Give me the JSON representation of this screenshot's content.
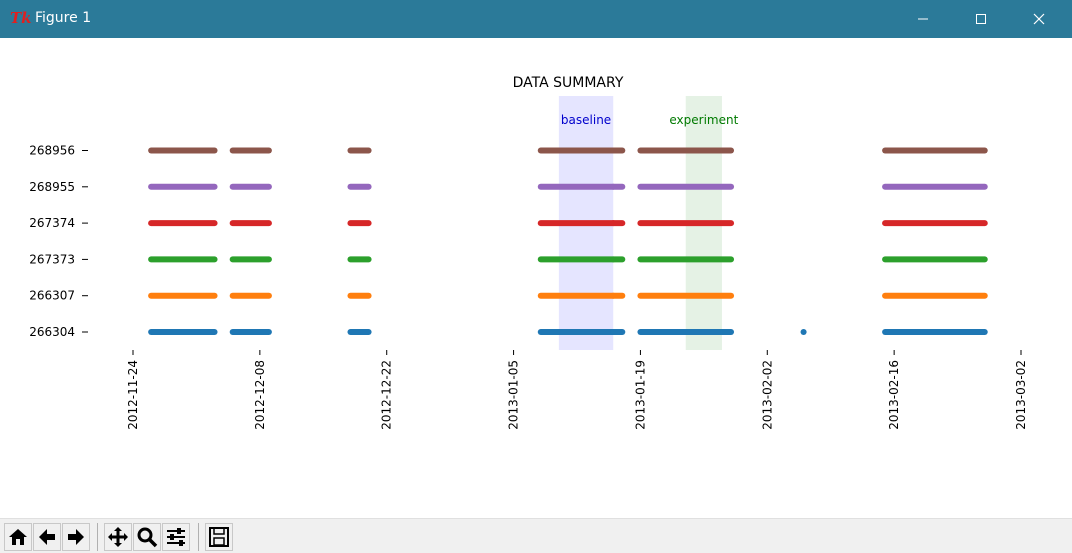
{
  "window": {
    "title": "Figure 1",
    "icon": "tk-feather-icon",
    "titlebar_color": "#2b7a99"
  },
  "toolbar": {
    "buttons": [
      "home-icon",
      "back-arrow-icon",
      "forward-arrow-icon",
      "pan-icon",
      "zoom-icon",
      "configure-subplots-icon",
      "save-icon"
    ]
  },
  "chart_data": {
    "type": "scatter",
    "title": "DATA SUMMARY",
    "xlabel": "",
    "ylabel": "",
    "x_type": "date",
    "xlim": [
      "2012-11-24",
      "2013-03-02"
    ],
    "x_ticks": [
      "2012-11-24",
      "2012-12-08",
      "2012-12-22",
      "2013-01-05",
      "2013-01-19",
      "2013-02-02",
      "2013-02-16",
      "2013-03-02"
    ],
    "categories": [
      "266304",
      "266307",
      "267373",
      "267374",
      "268955",
      "268956"
    ],
    "series_colors": [
      "#1f77b4",
      "#ff7f0e",
      "#2ca02c",
      "#d62728",
      "#9467bd",
      "#8c564b"
    ],
    "grid": false,
    "legend": "none",
    "spans": [
      {
        "label": "baseline",
        "start": "2013-01-10",
        "end": "2013-01-16",
        "color": "#0000ff",
        "opacity": 0.1
      },
      {
        "label": "experiment",
        "start": "2013-01-24",
        "end": "2013-01-28",
        "color": "#008000",
        "opacity": 0.1
      }
    ],
    "series": [
      {
        "category": "266304",
        "segments": [
          [
            "2012-11-26",
            "2012-12-03"
          ],
          [
            "2012-12-05",
            "2012-12-09"
          ],
          [
            "2012-12-18",
            "2012-12-20"
          ],
          [
            "2013-01-08",
            "2013-01-16"
          ],
          [
            "2013-01-16",
            "2013-01-17"
          ],
          [
            "2013-01-19",
            "2013-01-29"
          ],
          [
            "2013-02-06",
            "2013-02-06"
          ],
          [
            "2013-02-15",
            "2013-02-26"
          ]
        ]
      },
      {
        "category": "266307",
        "segments": [
          [
            "2012-11-26",
            "2012-12-03"
          ],
          [
            "2012-12-05",
            "2012-12-09"
          ],
          [
            "2012-12-18",
            "2012-12-20"
          ],
          [
            "2013-01-08",
            "2013-01-16"
          ],
          [
            "2013-01-16",
            "2013-01-17"
          ],
          [
            "2013-01-19",
            "2013-01-29"
          ],
          [
            "2013-02-15",
            "2013-02-26"
          ]
        ]
      },
      {
        "category": "267373",
        "segments": [
          [
            "2012-11-26",
            "2012-12-03"
          ],
          [
            "2012-12-05",
            "2012-12-09"
          ],
          [
            "2012-12-18",
            "2012-12-20"
          ],
          [
            "2013-01-08",
            "2013-01-16"
          ],
          [
            "2013-01-16",
            "2013-01-17"
          ],
          [
            "2013-01-19",
            "2013-01-29"
          ],
          [
            "2013-02-15",
            "2013-02-26"
          ]
        ]
      },
      {
        "category": "267374",
        "segments": [
          [
            "2012-11-26",
            "2012-12-03"
          ],
          [
            "2012-12-05",
            "2012-12-09"
          ],
          [
            "2012-12-18",
            "2012-12-20"
          ],
          [
            "2013-01-08",
            "2013-01-16"
          ],
          [
            "2013-01-16",
            "2013-01-17"
          ],
          [
            "2013-01-19",
            "2013-01-29"
          ],
          [
            "2013-02-15",
            "2013-02-26"
          ]
        ]
      },
      {
        "category": "268955",
        "segments": [
          [
            "2012-11-26",
            "2012-12-03"
          ],
          [
            "2012-12-05",
            "2012-12-09"
          ],
          [
            "2012-12-18",
            "2012-12-20"
          ],
          [
            "2013-01-08",
            "2013-01-16"
          ],
          [
            "2013-01-16",
            "2013-01-17"
          ],
          [
            "2013-01-19",
            "2013-01-29"
          ],
          [
            "2013-02-15",
            "2013-02-26"
          ]
        ]
      },
      {
        "category": "268956",
        "segments": [
          [
            "2012-11-26",
            "2012-12-03"
          ],
          [
            "2012-12-05",
            "2012-12-09"
          ],
          [
            "2012-12-18",
            "2012-12-20"
          ],
          [
            "2013-01-08",
            "2013-01-16"
          ],
          [
            "2013-01-16",
            "2013-01-17"
          ],
          [
            "2013-01-19",
            "2013-01-29"
          ],
          [
            "2013-02-15",
            "2013-02-26"
          ]
        ]
      }
    ]
  }
}
